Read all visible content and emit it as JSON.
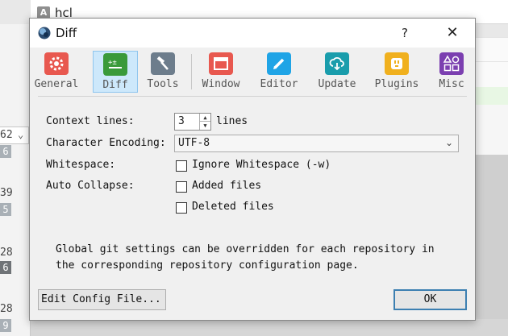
{
  "background": {
    "app_title": "hcl",
    "app_icon_letter": "A",
    "numbers": [
      "62",
      "6",
      "39",
      "5",
      "28",
      "6",
      "28",
      "9"
    ]
  },
  "dialog": {
    "title": "Diff",
    "help_label": "?",
    "close_label": "✕",
    "toolbar": [
      {
        "label": "General",
        "icon": "gear-icon",
        "color": "#e8584f",
        "active": false
      },
      {
        "label": "Diff",
        "icon": "diff-icon",
        "color": "#3a9a3a",
        "active": true
      },
      {
        "label": "Tools",
        "icon": "hammer-icon",
        "color": "#6d7d8c",
        "active": false
      },
      {
        "label": "Window",
        "icon": "window-icon",
        "color": "#e8584f",
        "active": false
      },
      {
        "label": "Editor",
        "icon": "pencil-icon",
        "color": "#1fa4e6",
        "active": false
      },
      {
        "label": "Update",
        "icon": "cloud-download-icon",
        "color": "#1a9dac",
        "active": false
      },
      {
        "label": "Plugins",
        "icon": "plug-icon",
        "color": "#f0b01e",
        "active": false
      },
      {
        "label": "Misc",
        "icon": "shapes-icon",
        "color": "#7b3fb0",
        "active": false
      }
    ],
    "context_lines": {
      "label": "Context lines:",
      "value": "3",
      "suffix": "lines"
    },
    "character_encoding": {
      "label": "Character Encoding:",
      "value": "UTF-8"
    },
    "whitespace": {
      "label": "Whitespace:",
      "option": "Ignore Whitespace (-w)",
      "checked": false
    },
    "auto_collapse": {
      "label": "Auto Collapse:",
      "options": [
        {
          "label": "Added files",
          "checked": false
        },
        {
          "label": "Deleted files",
          "checked": false
        }
      ]
    },
    "note_line1": "Global git settings can be overridden for each repository in",
    "note_line2": "the corresponding repository configuration page.",
    "buttons": {
      "edit_config": "Edit Config File...",
      "ok": "OK"
    }
  }
}
